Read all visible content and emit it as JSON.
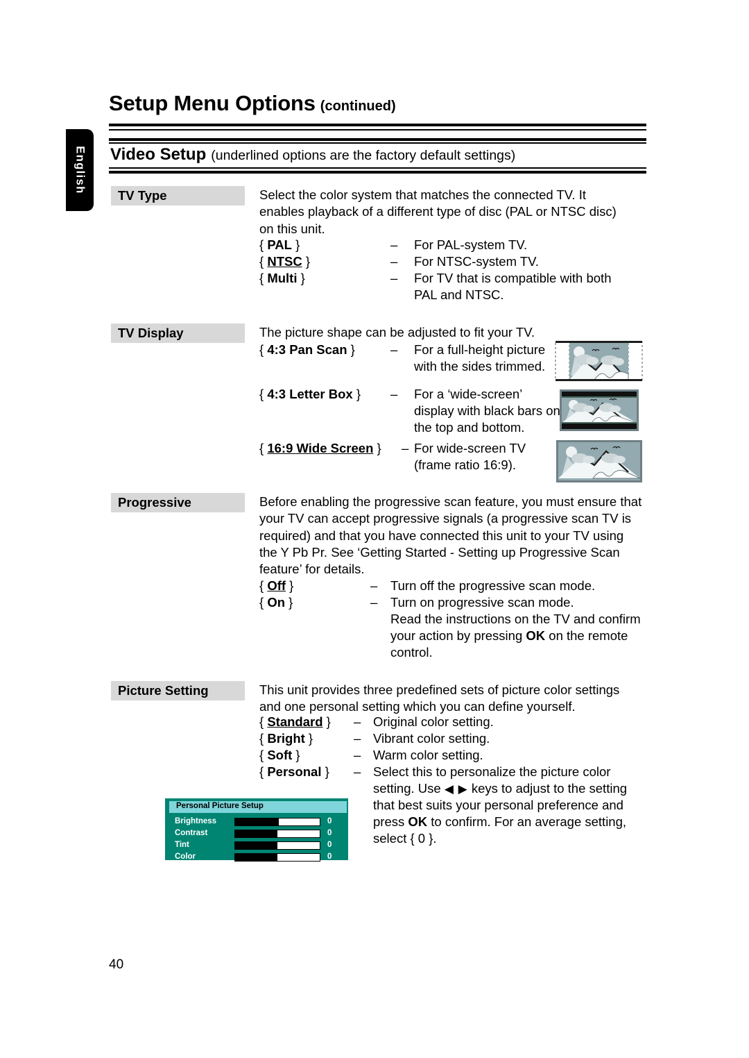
{
  "document": {
    "language_tab": "English",
    "title_main": "Setup Menu Options",
    "title_suffix": "(continued)",
    "section_title": "Video Setup",
    "section_note": "(underlined options are the factory default settings)",
    "page_number": "40"
  },
  "sections": [
    {
      "label": "TV Type",
      "intro": "Select the color system that matches the connected TV. It enables playback of a different type of disc (PAL or NTSC disc) on this unit.",
      "options": [
        {
          "name": "PAL",
          "underlined": false,
          "dash": "–",
          "desc": "For PAL-system TV."
        },
        {
          "name": "NTSC",
          "underlined": true,
          "dash": "–",
          "desc": "For NTSC-system TV."
        },
        {
          "name": "Multi",
          "underlined": false,
          "dash": "–",
          "desc": "For TV that is compatible with both PAL and NTSC."
        }
      ]
    },
    {
      "label": "TV Display",
      "intro": "The picture shape can be adjusted to fit your TV.",
      "options": [
        {
          "name": "4:3 Pan Scan",
          "underlined": false,
          "dash": "–",
          "desc": "For a full-height picture with the sides trimmed."
        },
        {
          "name": "4:3 Letter Box",
          "underlined": false,
          "dash": "–",
          "desc": "For a ‘wide-screen’ display with black bars on the top and bottom."
        },
        {
          "name": "16:9 Wide Screen",
          "underlined": true,
          "dash": "–",
          "desc": "For wide-screen TV (frame ratio 16:9)."
        }
      ],
      "thumbnails": [
        "pan-scan-tv-image",
        "letter-box-tv-image",
        "wide-screen-tv-image"
      ]
    },
    {
      "label": "Progressive",
      "intro": "Before enabling the progressive scan feature, you must ensure that your TV can accept progressive signals (a progressive scan TV is required) and that you have connected this unit to your TV using the Y Pb Pr.  See ‘Getting Started - Setting up Progressive Scan feature’ for details.",
      "options": [
        {
          "name": "Off",
          "underlined": true,
          "dash": "–",
          "desc": "Turn off the progressive scan mode."
        },
        {
          "name": "On",
          "underlined": false,
          "dash": "–",
          "desc": "Turn on progressive scan mode."
        }
      ],
      "extra_lines": [
        "Read the instructions on the TV and confirm",
        "your action by pressing ",
        "OK",
        " on the remote",
        "control."
      ]
    },
    {
      "label": "Picture Setting",
      "intro": "This unit provides three predefined sets of picture color settings and one personal setting which you can define yourself.",
      "options": [
        {
          "name": "Standard",
          "underlined": true,
          "dash": "–",
          "desc": "Original color setting."
        },
        {
          "name": "Bright",
          "underlined": false,
          "dash": "–",
          "desc": "Vibrant color setting."
        },
        {
          "name": "Soft",
          "underlined": false,
          "dash": "–",
          "desc": "Warm color setting."
        },
        {
          "name": "Personal",
          "underlined": false,
          "dash": "–",
          "desc": "Select this to personalize the picture color setting. Use ◀ ▶ keys to adjust to the setting that best suits your personal preference and press OK to confirm. For an average setting, select { 0 }."
        }
      ]
    }
  ],
  "personal_picture_setup": {
    "title": "Personal Picture Setup",
    "header_color": "#7fd5da",
    "panel_color": "#008573",
    "rows": [
      {
        "label": "Brightness",
        "value": "0",
        "fill_percent": 52
      },
      {
        "label": "Contrast",
        "value": "0",
        "fill_percent": 50
      },
      {
        "label": "Tint",
        "value": "0",
        "fill_percent": 50
      },
      {
        "label": "Color",
        "value": "0",
        "fill_percent": 50
      }
    ]
  },
  "text_runs": {
    "tv_type_l1": "Select the color system that matches the connected TV. It",
    "tv_type_l2": "enables playback of a different type of disc (PAL or NTSC disc)",
    "tv_type_l3": "on this unit.",
    "tv_type_multi_d2": "PAL and NTSC.",
    "tv_display_intro": "The picture shape can be adjusted to fit your TV.",
    "panscan_d1": "For a full-height picture",
    "panscan_d2": "with the sides trimmed.",
    "letterbox_d1": "For a ‘wide-screen’",
    "letterbox_d2": "display with black bars on",
    "letterbox_d3": "the top and bottom.",
    "wide_d1": "For wide-screen TV",
    "wide_d2": "(frame ratio 16:9).",
    "prog_l1": "Before enabling the progressive scan feature, you must ensure that",
    "prog_l2": "your TV can accept progressive signals (a progressive scan TV is",
    "prog_l3": "required) and that you have connected this unit to your TV using",
    "prog_l4": "the Y Pb Pr.  See ‘Getting Started - Setting up Progressive Scan",
    "prog_l5": "feature’ for details.",
    "prog_off_d": "Turn off the progressive scan mode.",
    "prog_on_d": "Turn on progressive scan mode.",
    "prog_on_d2": "Read the instructions on the TV and confirm",
    "prog_on_d3a": "your action by pressing ",
    "prog_on_d3b": "OK",
    "prog_on_d3c": " on the remote",
    "prog_on_d4": "control.",
    "pic_l1": "This unit provides three predefined sets of picture color settings",
    "pic_l2": "and one personal setting which you can define yourself.",
    "pic_standard_d": "Original color setting.",
    "pic_bright_d": "Vibrant color setting.",
    "pic_soft_d": "Warm color setting.",
    "pic_personal_d1": "Select this to personalize the picture color",
    "pic_personal_d2a": "setting. Use ",
    "pic_personal_d2b": "◀ ▶",
    "pic_personal_d2c": " keys to adjust to the setting",
    "pic_personal_d3": "that best suits your personal preference and",
    "pic_personal_d4a": "press ",
    "pic_personal_d4b": "OK",
    "pic_personal_d4c": " to confirm. For an average setting,",
    "pic_personal_d5": "select { 0 }."
  }
}
